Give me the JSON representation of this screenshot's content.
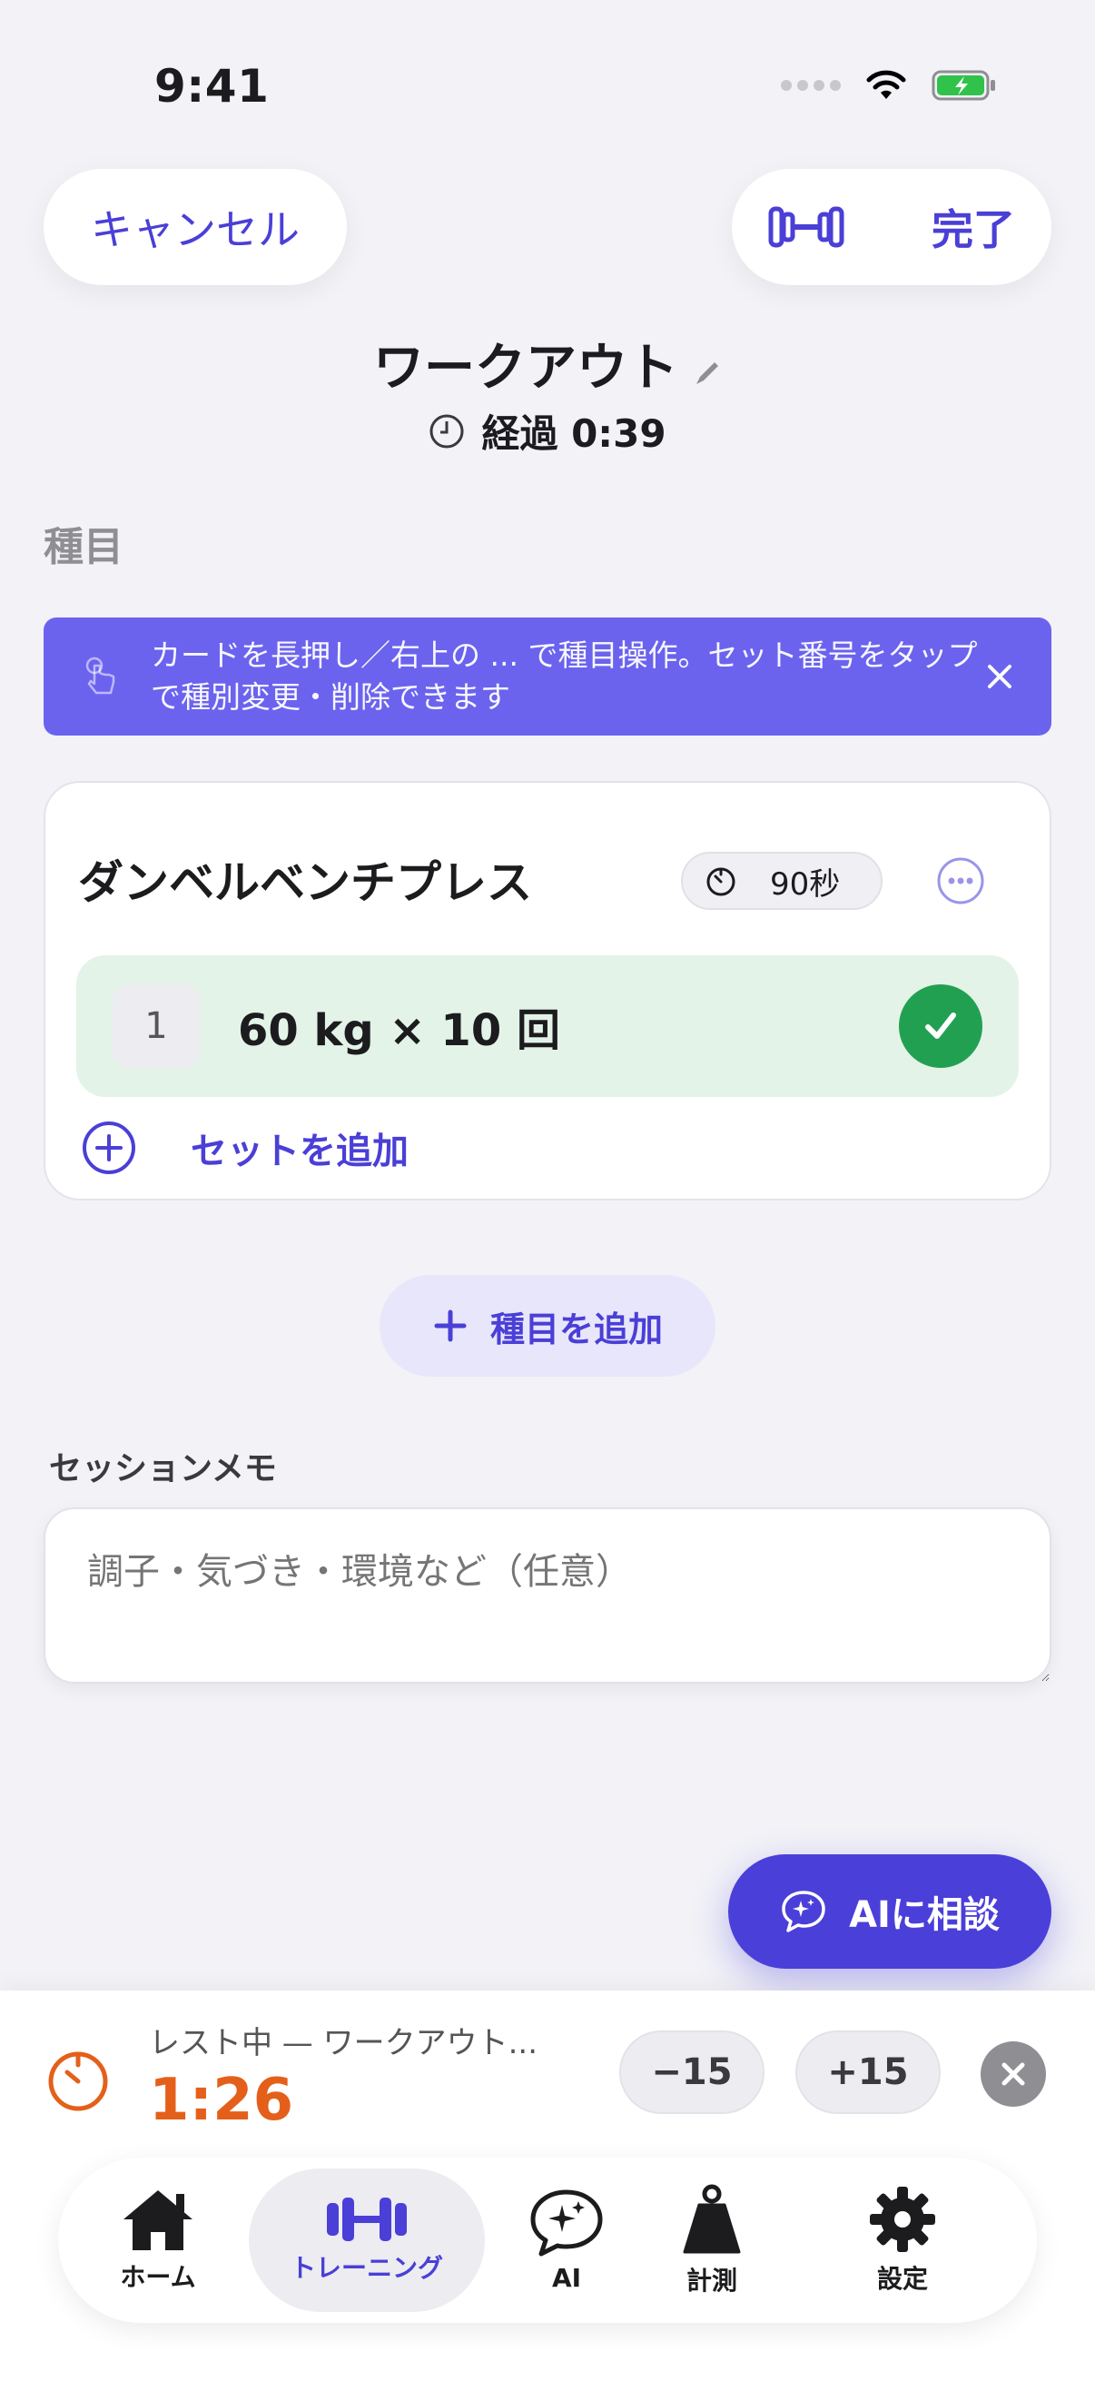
{
  "status_bar": {
    "time": "9:41"
  },
  "header": {
    "cancel_label": "キャンセル",
    "done_label": "完了",
    "title": "ワークアウト",
    "elapsed": "経過 0:39"
  },
  "section": {
    "label": "種目"
  },
  "hint": {
    "text": "カードを長押し／右上の ... で種目操作。セット番号をタップで種別変更・削除できます"
  },
  "exercise": {
    "name": "ダンベルベンチプレス",
    "rest_chip": "90秒",
    "sets": [
      {
        "number": "1",
        "value": "60 kg × 10 回",
        "done": true
      }
    ],
    "add_set_label": "セットを追加"
  },
  "add_exercise_label": "種目を追加",
  "memo": {
    "label": "セッションメモ",
    "placeholder": "調子・気づき・環境など（任意）"
  },
  "ai_button_label": "AIに相談",
  "rest_timer": {
    "label": "レスト中 — ワークアウト...",
    "time": "1:26",
    "minus_label": "−15",
    "plus_label": "+15"
  },
  "tabs": [
    {
      "label": "ホーム",
      "icon": "home-icon"
    },
    {
      "label": "トレーニング",
      "icon": "dumbbell-icon",
      "active": true
    },
    {
      "label": "AI",
      "icon": "ai-chat-icon"
    },
    {
      "label": "計測",
      "icon": "weight-icon"
    },
    {
      "label": "設定",
      "icon": "gear-icon"
    }
  ],
  "colors": {
    "accent": "#4a3fd6",
    "banner": "#6b63ee",
    "set_done_bg": "#e3f3e8",
    "check": "#22a052",
    "rest_time": "#e4601a"
  }
}
